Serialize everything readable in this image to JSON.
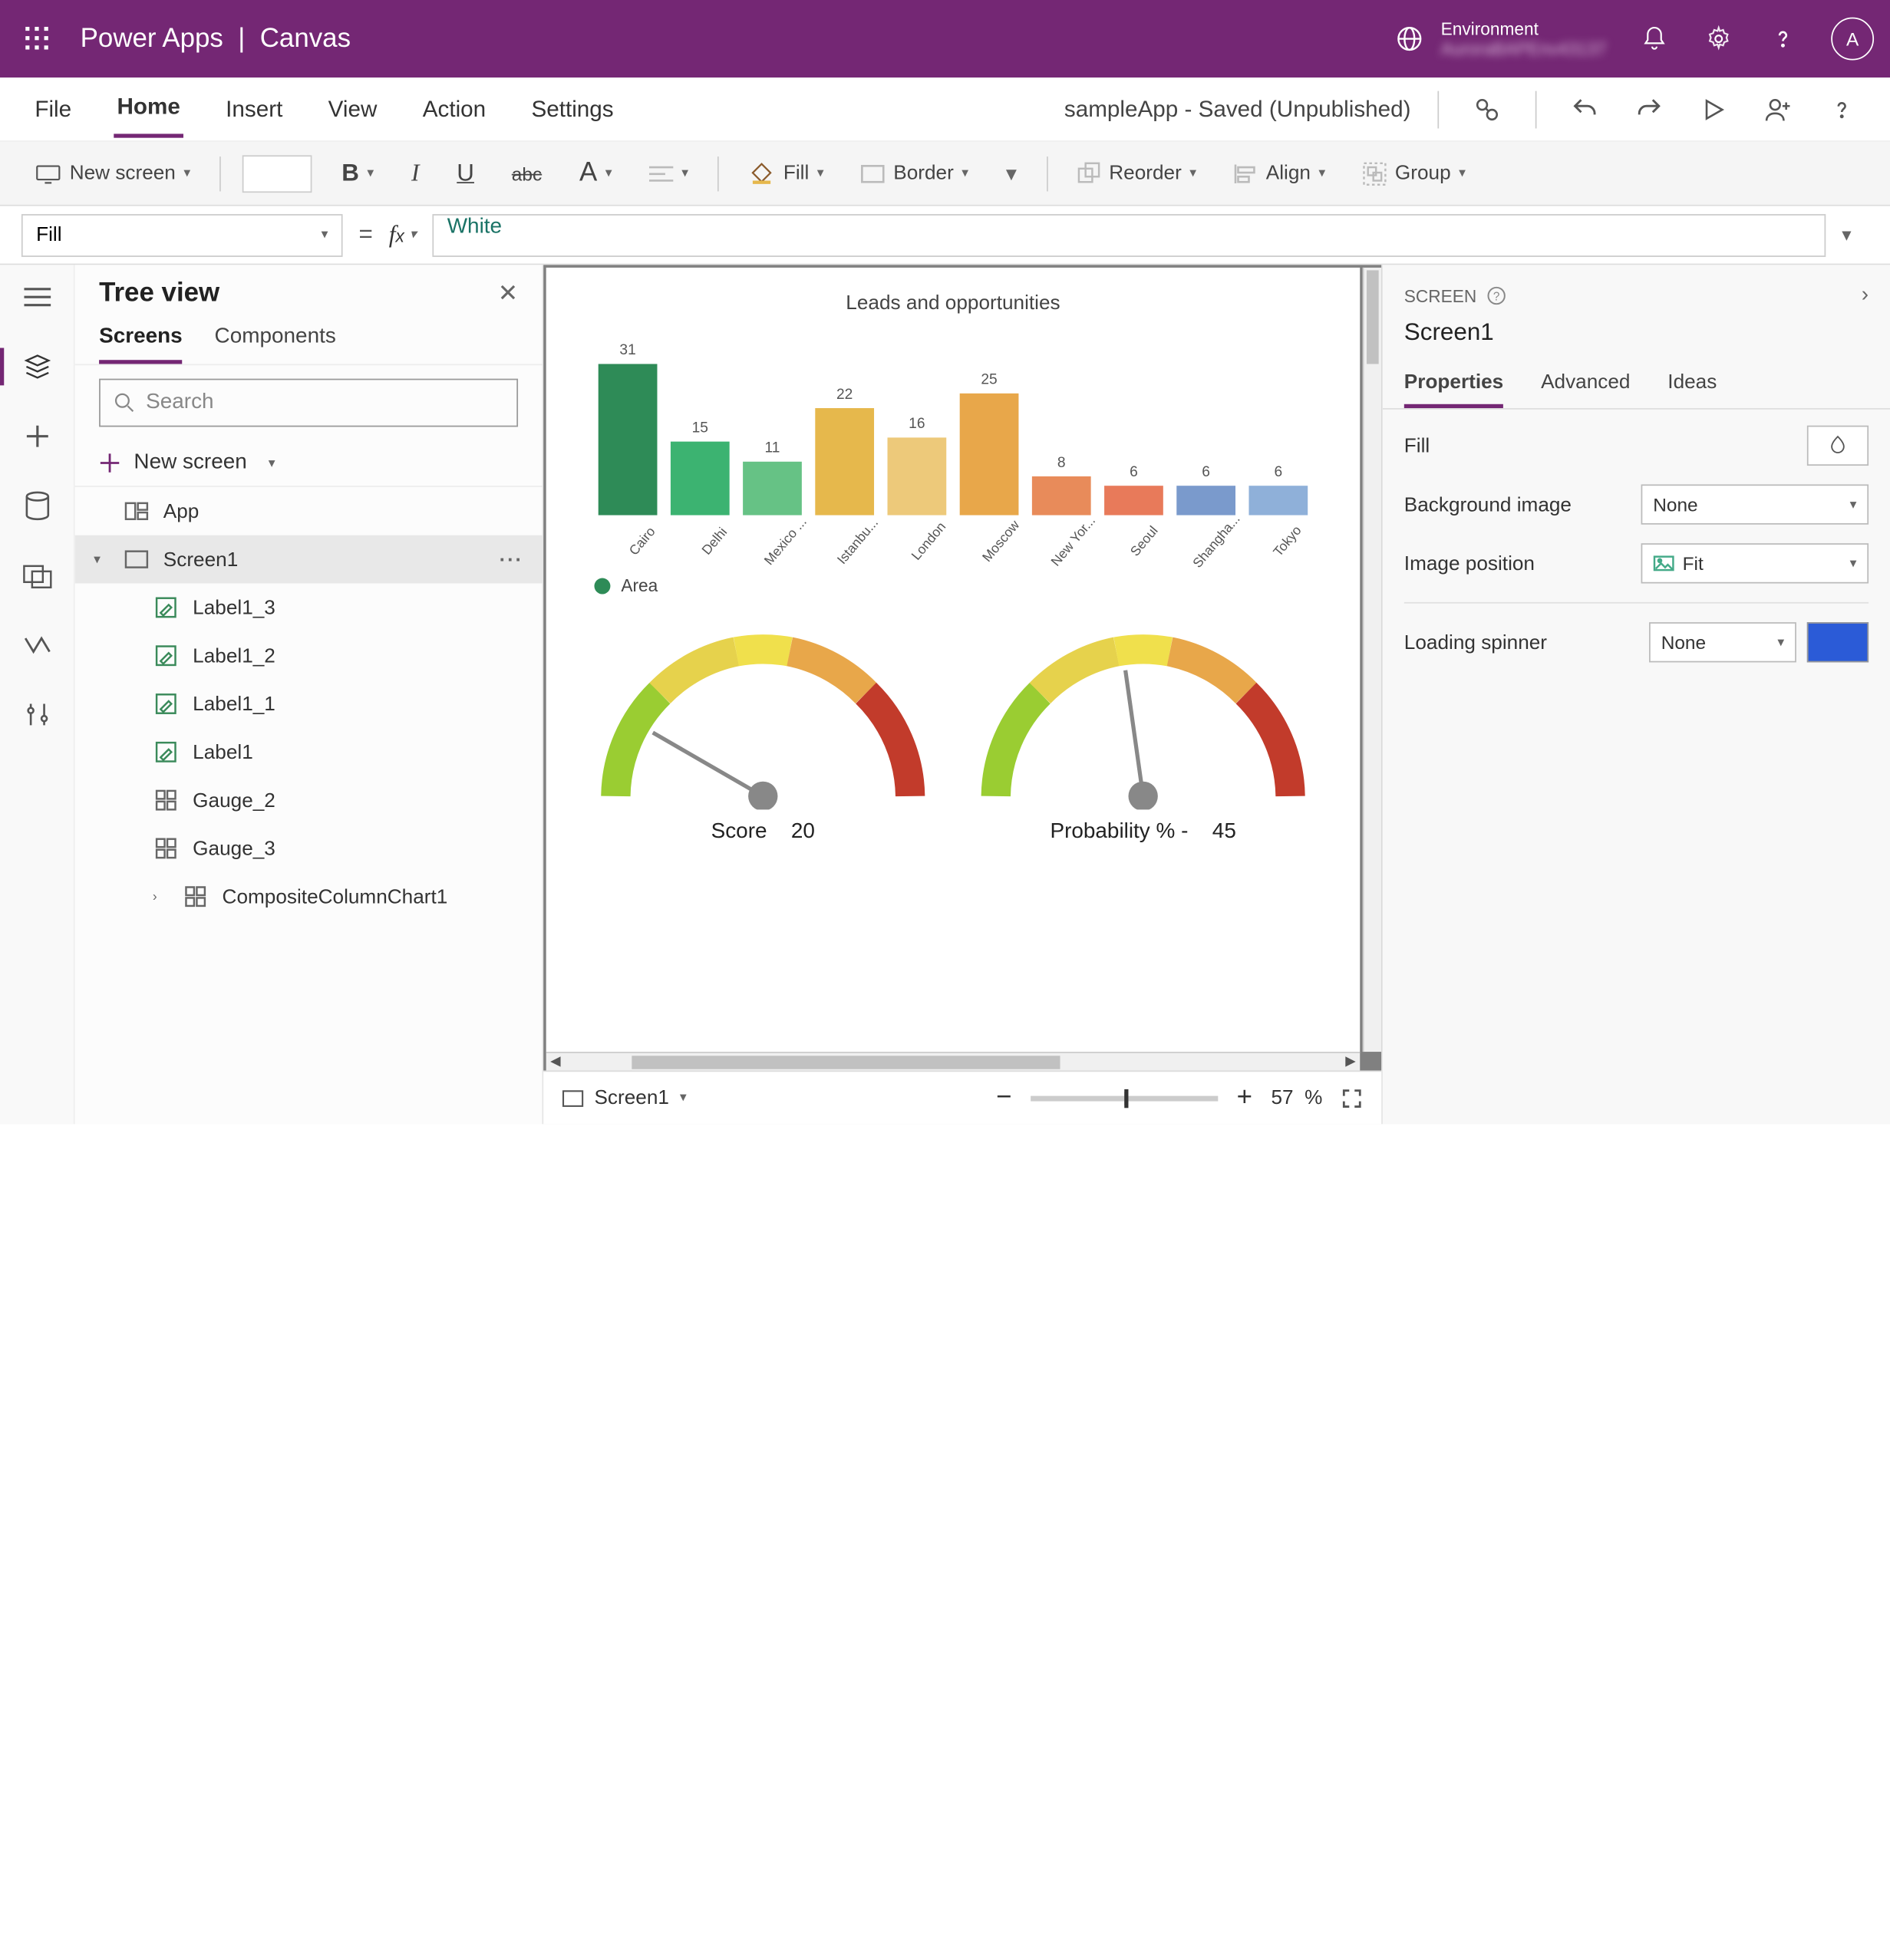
{
  "titlebar": {
    "appName": "Power Apps",
    "separator": "|",
    "mode": "Canvas",
    "envLabel": "Environment",
    "envName": "AuroraBAPEnv43137",
    "avatar": "A"
  },
  "menubar": {
    "items": [
      "File",
      "Home",
      "Insert",
      "View",
      "Action",
      "Settings"
    ],
    "activeIndex": 1,
    "saveStatus": "sampleApp - Saved (Unpublished)"
  },
  "ribbon": {
    "newScreen": "New screen",
    "fill": "Fill",
    "border": "Border",
    "reorder": "Reorder",
    "align": "Align",
    "group": "Group"
  },
  "formulaBar": {
    "property": "Fill",
    "value": "White"
  },
  "treeView": {
    "title": "Tree view",
    "tabs": [
      "Screens",
      "Components"
    ],
    "activeTab": 0,
    "searchPlaceholder": "Search",
    "newScreen": "New screen",
    "items": [
      {
        "label": "App",
        "icon": "app",
        "indent": 0
      },
      {
        "label": "Screen1",
        "icon": "screen",
        "indent": 0,
        "selected": true,
        "expand": true,
        "more": true
      },
      {
        "label": "Label1_3",
        "icon": "label",
        "indent": 2
      },
      {
        "label": "Label1_2",
        "icon": "label",
        "indent": 2
      },
      {
        "label": "Label1_1",
        "icon": "label",
        "indent": 2
      },
      {
        "label": "Label1",
        "icon": "label",
        "indent": 2
      },
      {
        "label": "Gauge_2",
        "icon": "gauge",
        "indent": 2
      },
      {
        "label": "Gauge_3",
        "icon": "gauge",
        "indent": 2
      },
      {
        "label": "CompositeColumnChart1",
        "icon": "chart",
        "indent": 2,
        "chev": true
      }
    ]
  },
  "canvas": {
    "screenSelector": "Screen1",
    "zoomPct": "57",
    "zoomUnit": "%"
  },
  "chart_data": {
    "type": "bar",
    "title": "Leads and opportunities",
    "legend": "Area",
    "categories": [
      "Cairo",
      "Delhi",
      "Mexico ...",
      "Istanbu...",
      "London",
      "Moscow",
      "New Yor...",
      "Seoul",
      "Shangha...",
      "Tokyo"
    ],
    "values": [
      31,
      15,
      11,
      22,
      16,
      25,
      8,
      6,
      6,
      6
    ],
    "colors": [
      "#2e8b57",
      "#3cb371",
      "#66c285",
      "#e6b84c",
      "#edc97a",
      "#e8a74a",
      "#e88b5a",
      "#e87a5a",
      "#7a9acc",
      "#8fb0d9"
    ],
    "ylim": [
      0,
      33
    ]
  },
  "gauges": [
    {
      "label": "Score",
      "value": "20",
      "needleDeg": -60
    },
    {
      "label": "Probability % -",
      "value": "45",
      "needleDeg": -8
    }
  ],
  "properties": {
    "header": "SCREEN",
    "name": "Screen1",
    "tabs": [
      "Properties",
      "Advanced",
      "Ideas"
    ],
    "activeTab": 0,
    "fields": {
      "fillLabel": "Fill",
      "bgImageLabel": "Background image",
      "bgImageValue": "None",
      "imgPosLabel": "Image position",
      "imgPosValue": "Fit",
      "spinnerLabel": "Loading spinner",
      "spinnerValue": "None"
    }
  }
}
